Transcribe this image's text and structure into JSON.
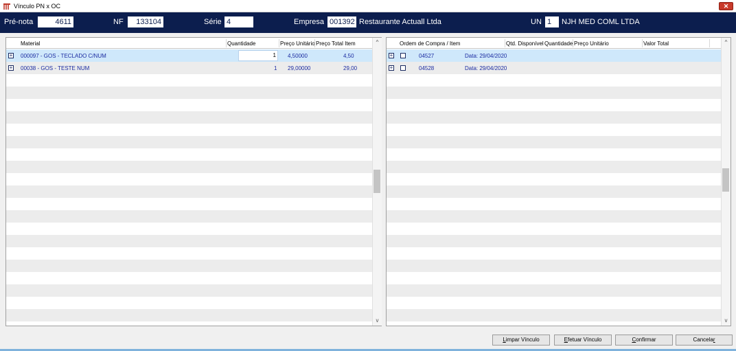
{
  "window": {
    "title": "Vínculo PN x OC",
    "close_label": "✕"
  },
  "header": {
    "prenota_label": "Pré-nota",
    "prenota_value": "4611",
    "nf_label": "NF",
    "nf_value": "133104",
    "serie_label": "Série",
    "serie_value": "4",
    "empresa_label": "Empresa",
    "empresa_code": "001392",
    "empresa_name": "Restaurante Actuall Ltda",
    "un_label": "UN",
    "un_value": "1",
    "un_name": "NJH MED COML LTDA"
  },
  "left_grid": {
    "columns": [
      "Material",
      "Quantidade",
      "Preço Unitário",
      "Preço Total Item"
    ],
    "rows": [
      {
        "material": "000097 - GOS - TECLADO C/NUM",
        "quantidade": "1",
        "preco_unitario": "4,50000",
        "preco_total": "4,50"
      },
      {
        "material": "00038 - GOS - TESTE NUM",
        "quantidade": "1",
        "preco_unitario": "29,00000",
        "preco_total": "29,00"
      }
    ]
  },
  "right_grid": {
    "columns": [
      "Ordem de Compra / Item",
      "Qtd. Disponível",
      "Quantidade",
      "Preço Unitário",
      "Valor Total"
    ],
    "rows": [
      {
        "ordem": "04527",
        "data": "Data: 29/04/2020"
      },
      {
        "ordem": "04528",
        "data": "Data: 29/04/2020"
      }
    ]
  },
  "buttons": {
    "limpar": {
      "key": "L",
      "rest": "impar Vínculo"
    },
    "efetuar": {
      "key": "E",
      "rest": "fetuar Vínculo"
    },
    "confirmar": {
      "key": "C",
      "rest": "onfirmar"
    },
    "cancelar": {
      "pre": "Cancela",
      "key": "r",
      "rest": ""
    }
  },
  "scroll": {
    "up": "^",
    "down": "v"
  },
  "icons": {
    "expander": "+"
  },
  "colors": {
    "header_bg": "#0c1e4e",
    "selected_row": "#cfe8fb",
    "link_text": "#1a2aa0",
    "close_btn": "#c83a2a"
  }
}
